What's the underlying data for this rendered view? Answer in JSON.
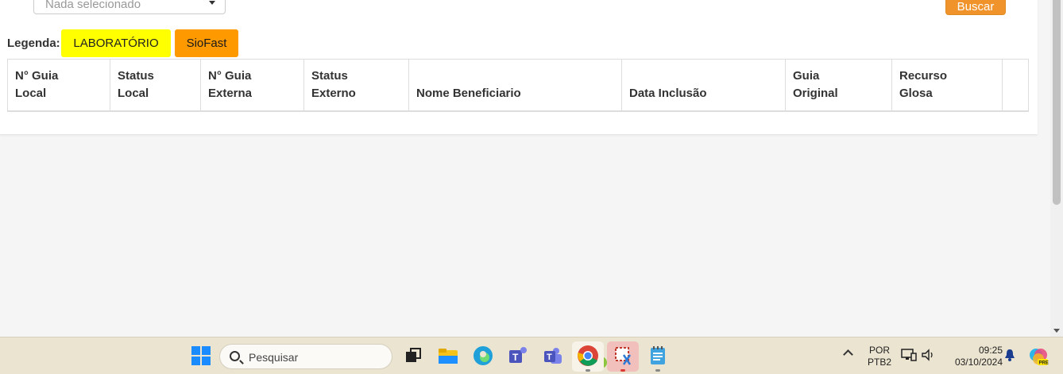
{
  "filter": {
    "select_value": "Nada selecionado",
    "search_button": "Buscar"
  },
  "legend": {
    "label": "Legenda:",
    "items": [
      {
        "label": "LABORATÓRIO",
        "color": "#ffff00"
      },
      {
        "label": "SioFast",
        "color": "#ff9900"
      }
    ]
  },
  "table": {
    "headers": [
      {
        "line1": "N° Guia",
        "line2": "Local"
      },
      {
        "line1": "Status",
        "line2": "Local"
      },
      {
        "line1": "N° Guia",
        "line2": "Externa"
      },
      {
        "line1": "Status",
        "line2": "Externo"
      },
      {
        "line1": "",
        "line2": "Nome Beneficiario"
      },
      {
        "line1": "",
        "line2": "Data Inclusão"
      },
      {
        "line1": "Guia",
        "line2": "Original"
      },
      {
        "line1": "Recurso",
        "line2": "Glosa"
      },
      {
        "line1": "",
        "line2": ""
      }
    ]
  },
  "taskbar": {
    "search_placeholder": "Pesquisar",
    "apps": [
      "windows-start-icon",
      "search-icon",
      "task-view-icon",
      "file-explorer-icon",
      "edge-icon",
      "teams-icon",
      "teams-classic-icon",
      "chrome-icon",
      "snipping-tool-icon",
      "notepad-icon"
    ],
    "language_line1": "POR",
    "language_line2": "PTB2",
    "time": "09:25",
    "date": "03/10/2024"
  }
}
